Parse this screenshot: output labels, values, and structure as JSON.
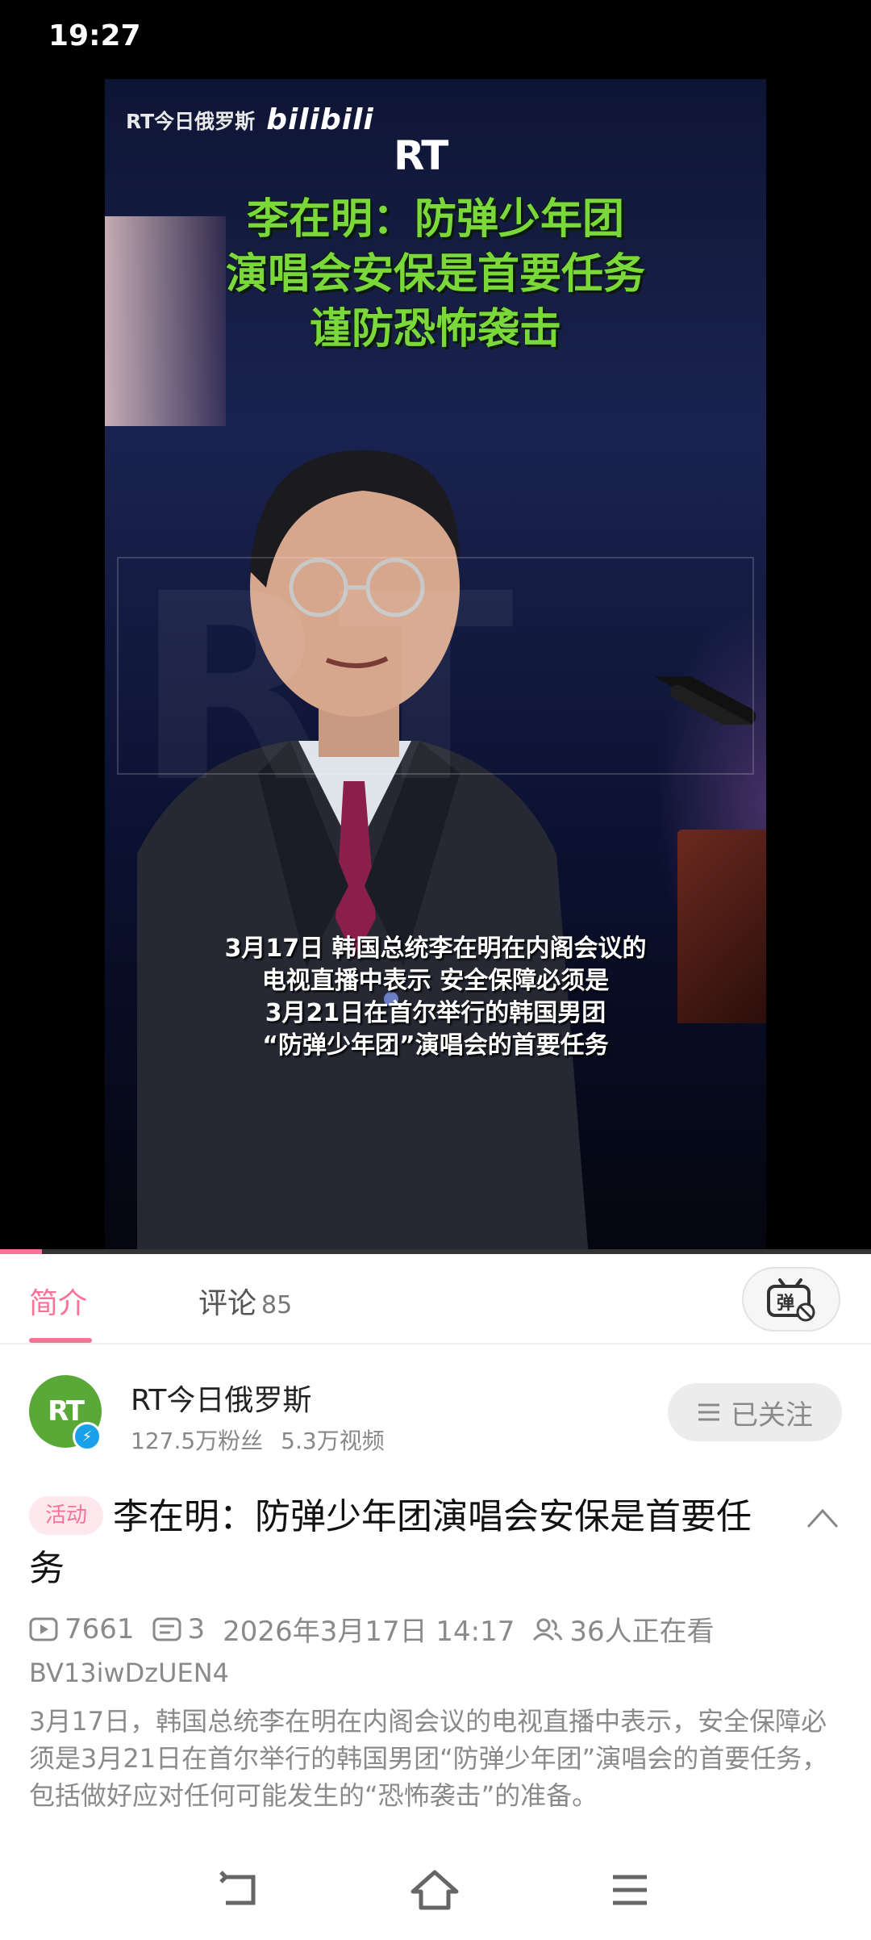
{
  "status_bar": {
    "time": "19:27"
  },
  "video": {
    "brand": "RT今日俄罗斯",
    "platform_logo": "bilibili",
    "rt_logo": "RT",
    "headline": [
      "李在明：防弹少年团",
      "演唱会安保是首要任务",
      "谨防恐怖袭击"
    ],
    "caption": [
      "3月17日  韩国总统李在明在内阁会议的",
      "电视直播中表示  安全保障必须是",
      "3月21日在首尔举行的韩国男团",
      "“防弹少年团”演唱会的首要任务"
    ],
    "watermark": "RT",
    "progress_fraction": 0.048,
    "accent_color": "#fb7299",
    "headline_color": "#7bd83a"
  },
  "tabs": {
    "intro_label": "简介",
    "comments_label": "评论",
    "comments_count": "85",
    "danmaku_icon": "danmaku-toggle-icon"
  },
  "uploader": {
    "avatar_text": "RT",
    "name": "RT今日俄罗斯",
    "fans": "127.5万粉丝",
    "videos": "5.3万视频",
    "follow_label": "已关注"
  },
  "video_info": {
    "tag": "活动",
    "title": "李在明：防弹少年团演唱会安保是首要任务",
    "plays": "7661",
    "danmaku_count": "3",
    "datetime": "2026年3月17日 14:17",
    "watching": "36人正在看",
    "bvid": "BV13iwDzUEN4",
    "description": "3月17日，韩国总统李在明在内阁会议的电视直播中表示，安全保障必须是3月21日在首尔举行的韩国男团“防弹少年团”演唱会的首要任务，包括做好应对任何可能发生的“恐怖袭击”的准备。"
  },
  "navbar": {
    "back_icon": "back-icon",
    "home_icon": "home-icon",
    "menu_icon": "menu-icon"
  }
}
